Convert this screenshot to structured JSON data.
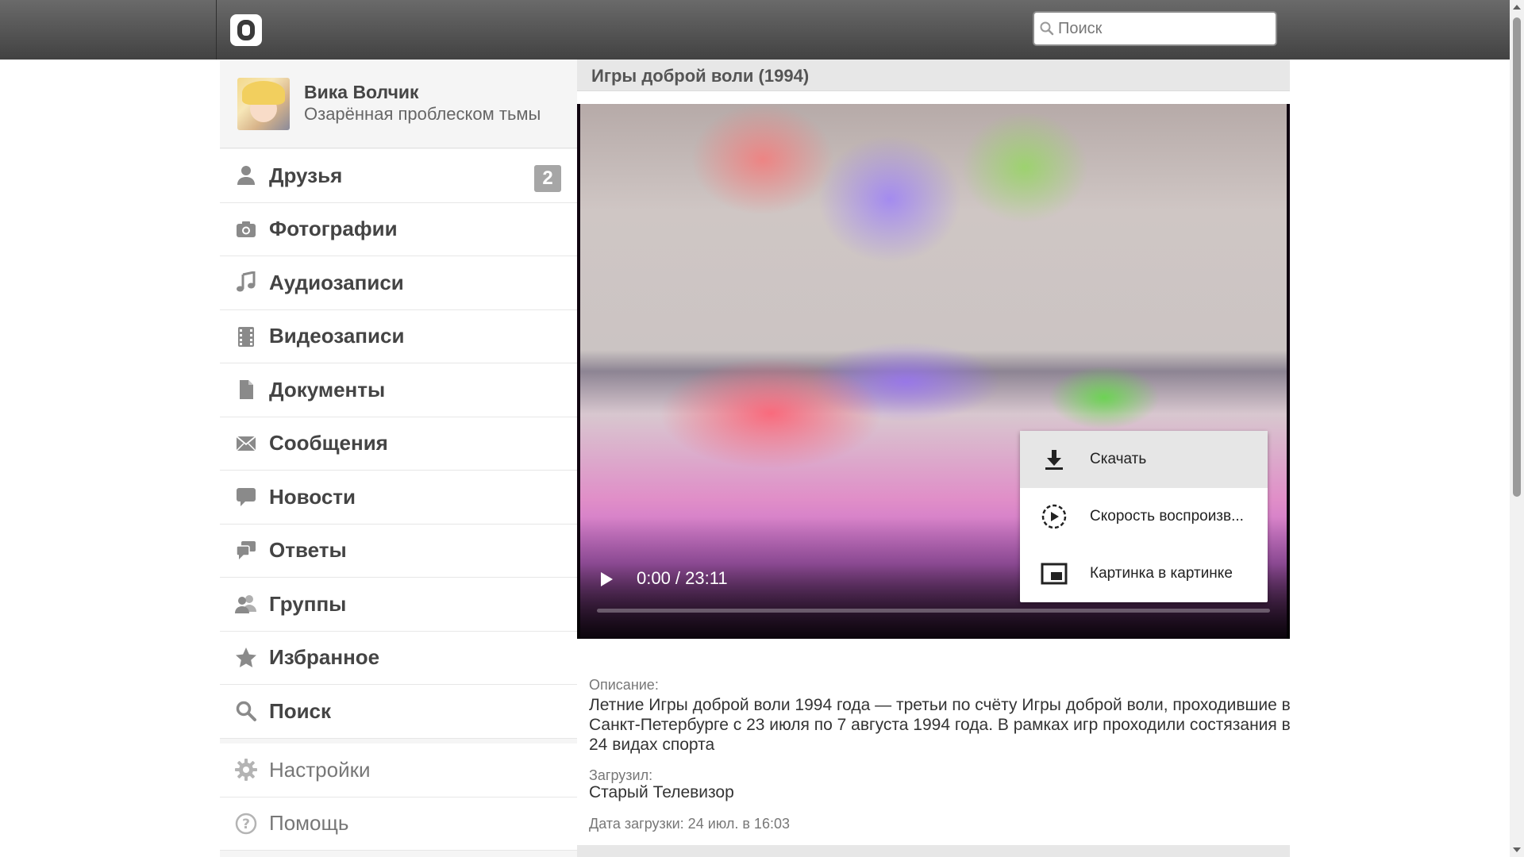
{
  "header": {
    "search_placeholder": "Поиск"
  },
  "profile": {
    "name": "Вика Волчик",
    "status": "Озарённая проблеском тьмы"
  },
  "nav": {
    "items": [
      {
        "label": "Друзья",
        "icon": "user-icon",
        "badge": "2"
      },
      {
        "label": "Фотографии",
        "icon": "camera-icon"
      },
      {
        "label": "Аудиозаписи",
        "icon": "music-note-icon"
      },
      {
        "label": "Видеозаписи",
        "icon": "film-icon"
      },
      {
        "label": "Документы",
        "icon": "document-icon"
      },
      {
        "label": "Сообщения",
        "icon": "envelope-icon"
      },
      {
        "label": "Новости",
        "icon": "speech-bubble-icon"
      },
      {
        "label": "Ответы",
        "icon": "chat-bubbles-icon"
      },
      {
        "label": "Группы",
        "icon": "group-icon"
      },
      {
        "label": "Избранное",
        "icon": "star-icon"
      },
      {
        "label": "Поиск",
        "icon": "search-icon"
      }
    ],
    "secondary": [
      {
        "label": "Настройки",
        "icon": "gear-icon"
      },
      {
        "label": "Помощь",
        "icon": "help-icon"
      }
    ]
  },
  "video": {
    "title": "Игры доброй воли (1994)",
    "time": "0:00 / 23:11",
    "menu": [
      {
        "label": "Скачать",
        "icon": "download-icon"
      },
      {
        "label": "Скорость воспроизв...",
        "icon": "playback-speed-icon"
      },
      {
        "label": "Картинка в картинке",
        "icon": "picture-in-picture-icon"
      }
    ]
  },
  "details": {
    "description_label": "Описание:",
    "description": "Летние Игры доброй воли 1994 года — третьи по счёту Игры доброй воли, проходившие в Санкт-Петербурге с 23 июля по 7 августа 1994 года. В рамках игр проходили состязания в 24 видах спорта",
    "uploader_label": "Загрузил:",
    "uploader": "Старый Телевизор",
    "upload_date": "Дата загрузки: 24 июл. в 16:03"
  },
  "colors": {
    "header_top": "#6a6a6a",
    "header_bottom": "#424242",
    "sidebar_bg": "#f5f5f5",
    "nav_text": "#444444",
    "badge_bg": "#a6a6a6",
    "title_bar_bg": "#e7e7e7"
  }
}
